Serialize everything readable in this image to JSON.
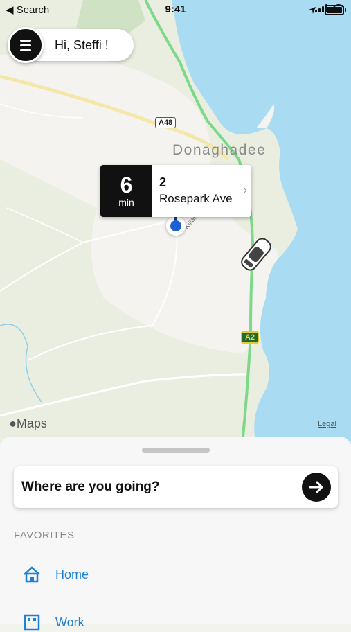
{
  "status_bar": {
    "back_label": "◀ Search",
    "time": "9:41"
  },
  "greeting": "Hi, Steffi !",
  "map": {
    "place_label": "Donaghadee",
    "road_labels": [
      "A48",
      "A2"
    ],
    "street_label": "Killaughey",
    "attribution": "Maps",
    "legal": "Legal"
  },
  "eta_card": {
    "minutes": "6",
    "unit": "min",
    "address_line1": "2",
    "address_line2": "Rosepark Ave"
  },
  "search": {
    "placeholder": "Where are you going?"
  },
  "favorites": {
    "title": "FAVORITES",
    "items": [
      {
        "label": "Home",
        "icon": "home-icon"
      },
      {
        "label": "Work",
        "icon": "work-icon"
      }
    ]
  },
  "colors": {
    "water": "#a9dcf2",
    "land": "#eaeee0",
    "town": "#f4f3ef",
    "route": "#7dd88a",
    "accent": "#1e7fd6"
  }
}
